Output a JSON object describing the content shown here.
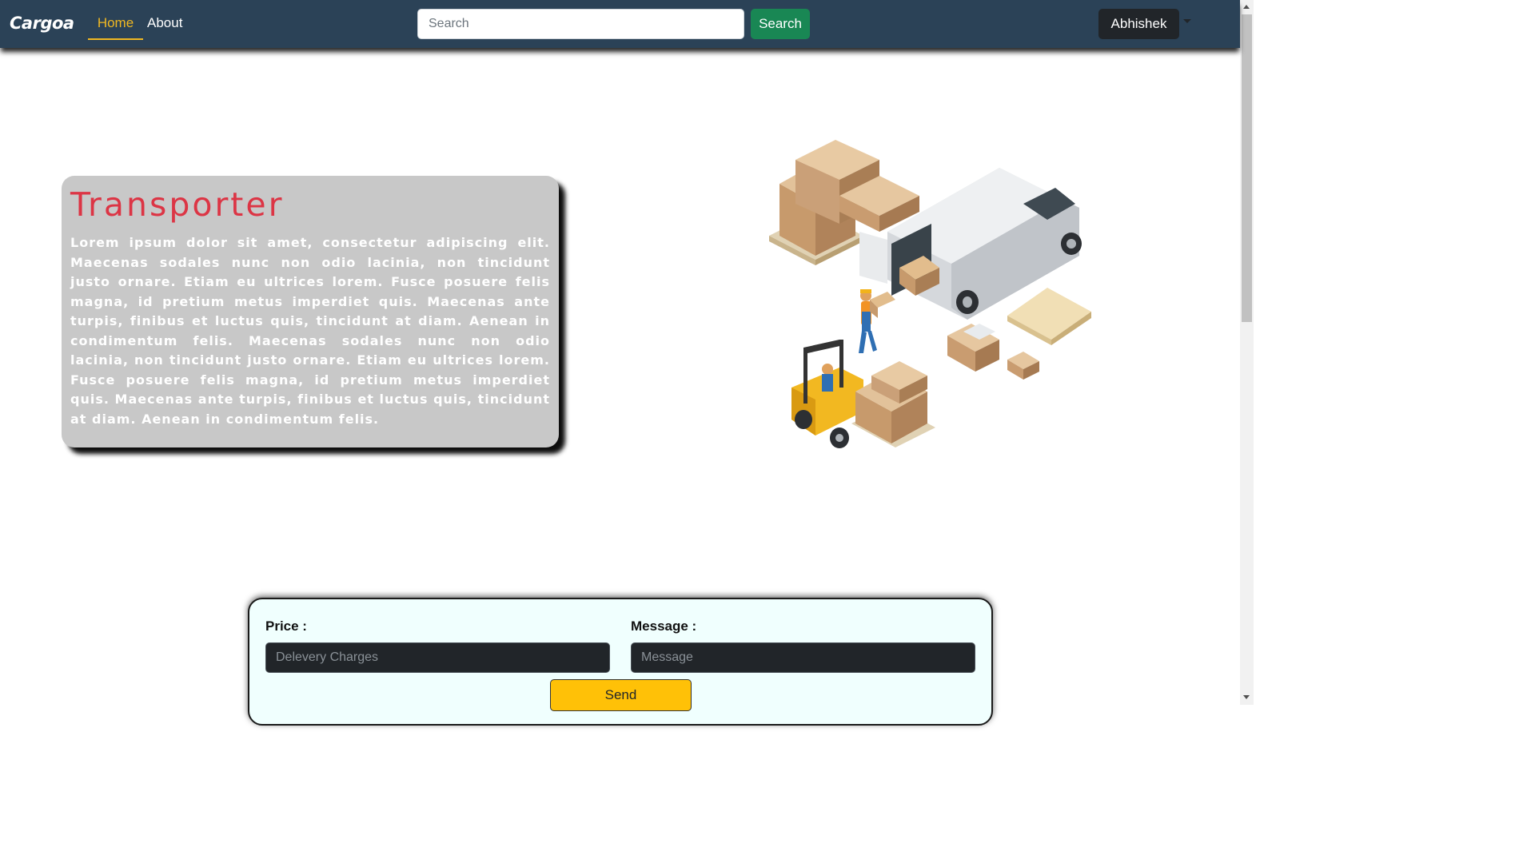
{
  "navbar": {
    "brand": "Cargoa",
    "links": [
      {
        "label": "Home"
      },
      {
        "label": "About"
      }
    ],
    "search": {
      "placeholder": "Search",
      "button_label": "Search"
    },
    "user": {
      "name": "Abhishek"
    }
  },
  "hero": {
    "title": "Transporter",
    "body": "Lorem ipsum dolor sit amet, consectetur adipiscing elit. Maecenas sodales nunc non odio lacinia, non tincidunt justo ornare. Etiam eu ultrices lorem. Fusce posuere felis magna, id pretium metus imperdiet quis. Maecenas ante turpis, finibus et luctus quis, tincidunt at diam. Aenean in condimentum felis. Maecenas sodales nunc non odio lacinia, non tincidunt justo ornare. Etiam eu ultrices lorem. Fusce posuere felis magna, id pretium metus imperdiet quis. Maecenas ante turpis, finibus et luctus quis, tincidunt at diam. Aenean in condimentum felis."
  },
  "form": {
    "price_label": "Price :",
    "price_placeholder": "Delevery Charges",
    "message_label": "Message :",
    "message_placeholder": "Message",
    "send_label": "Send"
  },
  "colors": {
    "navbar": "#2b4257",
    "active_link": "#f0b822",
    "search_button": "#198754",
    "title": "#dc3545",
    "send_button": "#ffc107"
  }
}
